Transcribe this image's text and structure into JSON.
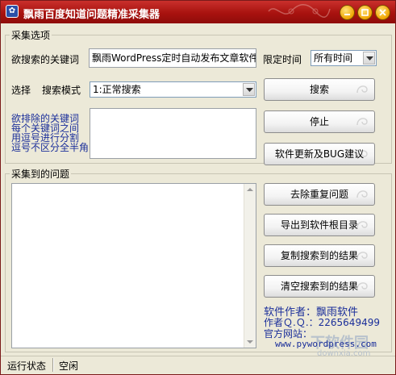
{
  "window": {
    "title": "飘雨百度知道问题精准采集器",
    "icon_name": "app-icon",
    "titlebar_color": "#b3201c"
  },
  "options": {
    "group_label": "采集选项",
    "keyword_label": "欲搜索的关键词",
    "keyword_value": "飘雨WordPress定时自动发布文章软件",
    "time_label": "限定时间",
    "time_value": "所有时间",
    "mode_prefix": "选择",
    "mode_label": "搜索模式",
    "mode_value": "1:正常搜索",
    "exclude_hint": [
      "欲排除的关键词",
      "每个关键词之间",
      "用逗号进行分割",
      "逗号不区分全半角"
    ]
  },
  "buttons": {
    "search": "搜索",
    "stop": "停止",
    "update": "软件更新及BUG建议",
    "dedupe": "去除重复问题",
    "export": "导出到软件根目录",
    "copy": "复制搜索到的结果",
    "clear": "清空搜索到的结果"
  },
  "results": {
    "group_label": "采集到的问题"
  },
  "info": {
    "author": "软件作者：飘雨软件",
    "qq": "作者Ｑ.Ｑ.：2265649499",
    "site_label": "官方网站：",
    "site_url": "www.pywordpress.com"
  },
  "watermark": {
    "text": "下软件园",
    "sub": "downxia.com"
  },
  "status": {
    "label": "运行状态",
    "value": "空闲"
  }
}
